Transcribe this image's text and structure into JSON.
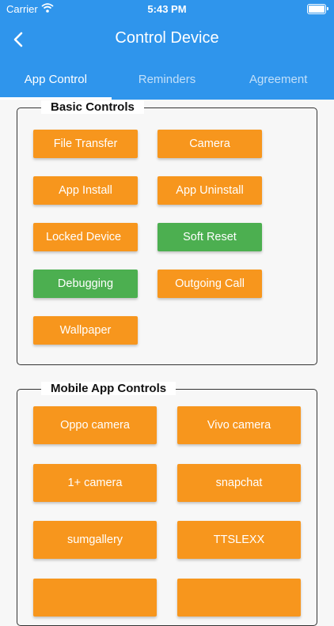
{
  "status_bar": {
    "carrier": "Carrier",
    "time": "5:43 PM"
  },
  "app_bar": {
    "title": "Control Device"
  },
  "tabs": [
    {
      "label": "App Control",
      "active": true
    },
    {
      "label": "Reminders",
      "active": false
    },
    {
      "label": "Agreement",
      "active": false
    }
  ],
  "basic_controls": {
    "title": "Basic Controls",
    "buttons": [
      {
        "label": "File Transfer",
        "color": "#f7961d"
      },
      {
        "label": "Camera",
        "color": "#f7961d"
      },
      {
        "label": "App Install",
        "color": "#f7961d"
      },
      {
        "label": "App Uninstall",
        "color": "#f7961d"
      },
      {
        "label": "Locked Device",
        "color": "#f7961d"
      },
      {
        "label": "Soft Reset",
        "color": "#4caf50"
      },
      {
        "label": "Debugging",
        "color": "#4caf50"
      },
      {
        "label": "Outgoing Call",
        "color": "#f7961d"
      },
      {
        "label": "Wallpaper",
        "color": "#f7961d"
      }
    ]
  },
  "mobile_app_controls": {
    "title": "Mobile App Controls",
    "buttons": [
      {
        "label": "Oppo camera"
      },
      {
        "label": "Vivo camera"
      },
      {
        "label": "1+ camera"
      },
      {
        "label": "snapchat"
      },
      {
        "label": "sumgallery"
      },
      {
        "label": "TTSLEXX"
      }
    ]
  },
  "colors": {
    "primary": "#2f95ec",
    "accent": "#f7961d",
    "success": "#4caf50"
  }
}
